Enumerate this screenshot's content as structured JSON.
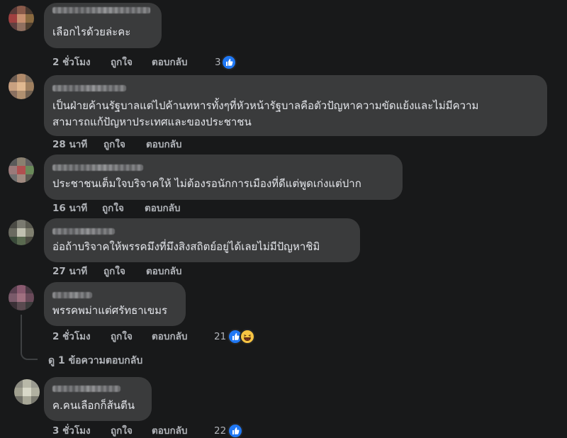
{
  "comments": [
    {
      "text": "เลือกไรด้วยล่ะคะ",
      "time": "2 ชั่วโมง",
      "like": "ถูกใจ",
      "reply": "ตอบกลับ",
      "reaction_count": "3",
      "reactions": [
        "like-icon"
      ]
    },
    {
      "text_line1": "เป็นฝ่ายค้านรัฐบาลแต่ไปค้านทหารทั้งๆที่หัวหน้ารัฐบาลคือตัวปัญหาความขัดแย้งและไม่มีความ",
      "text_line2": "สามารถแก้ปัญหาประเทศและของประชาชน",
      "time": "28 นาที",
      "like": "ถูกใจ",
      "reply": "ตอบกลับ"
    },
    {
      "text": "ประชาชนเต็มใจบริจาคให้ ไม่ต้องรอนักการเมืองที่ดีแต่พูดเก่งแต่ปาก",
      "time": "16 นาที",
      "like": "ถูกใจ",
      "reply": "ตอบกลับ"
    },
    {
      "text": "อ่อถ้าบริจาคให้พรรคมึงที่มึงสิงสถิตย์อยู่ได้เลยไม่มีปัญหาชิมิ",
      "time": "27 นาที",
      "like": "ถูกใจ",
      "reply": "ตอบกลับ"
    },
    {
      "text": "พรรคพม่าแต่ศรัทธาเขมร",
      "time": "2 ชั่วโมง",
      "like": "ถูกใจ",
      "reply": "ตอบกลับ",
      "reaction_count": "21",
      "reactions": [
        "like-icon",
        "haha-icon"
      ],
      "view_replies": "ดู 1 ข้อความตอบกลับ"
    },
    {
      "text": "ค.คนเลือกก็ส้นตีน",
      "time": "3 ชั่วโมง",
      "like": "ถูกใจ",
      "reply": "ตอบกลับ",
      "reaction_count": "22",
      "reactions": [
        "like-icon"
      ]
    }
  ],
  "colors": {
    "background": "#18191a",
    "bubble": "#3a3b3c",
    "text": "#e4e6eb",
    "secondary_text": "#b0b3b8",
    "like_blue": "#2078f4",
    "haha_yellow": "#f7c443"
  }
}
